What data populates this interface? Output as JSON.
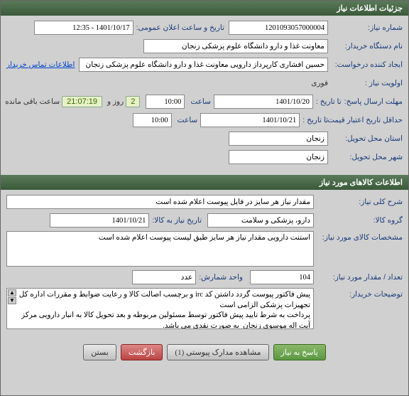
{
  "header": {
    "title": "جزئیات اطلاعات نیاز"
  },
  "form": {
    "need_number_label": "شماره نیاز:",
    "need_number": "1201093057000004",
    "public_date_label": "تاریخ و ساعت اعلان عمومی:",
    "public_date": "1401/10/17 - 12:35",
    "buyer_name_label": "نام دستگاه خریدار:",
    "buyer_name": "معاونت غذا و دارو دانشگاه علوم پزشکی زنجان",
    "requester_label": "ایجاد کننده درخواست:",
    "requester": "حسین افشاری کارپرداز دارویی معاونت غذا و دارو دانشگاه علوم پزشکی زنجان",
    "buyer_contact_link": "اطلاعات تماس خریدار",
    "priority_label": "اولویت نیاز :",
    "priority": "فوری",
    "reply_deadline_label": "مهلت ارسال پاسخ:",
    "to_date_label": "تا تاریخ :",
    "reply_date": "1401/10/20",
    "reply_time_label": "ساعت",
    "reply_time": "10:00",
    "remaining_days": "2",
    "remaining_days_label": "روز و",
    "remaining_time": "21:07:19",
    "remaining_suffix": "ساعت باقی مانده",
    "credit_deadline_label": "حداقل تاریخ اعتبار قیمت:",
    "credit_date": "1401/10/21",
    "credit_time_label": "ساعت",
    "credit_time": "10:00",
    "delivery_state_label": "استان محل تحویل:",
    "delivery_state": "زنجان",
    "delivery_city_label": "شهر محل تحویل:",
    "delivery_city": "زنجان"
  },
  "goods_section": {
    "title": "اطلاعات کالاهای مورد نیاز",
    "need_desc_label": "شرح کلی نیاز:",
    "need_desc": "مقدار نیاز هر سایز در فایل پیوست اعلام شده است",
    "goods_group_label": "گروه کالا:",
    "goods_group": "دارو، پزشکی و سلامت",
    "need_to_goods_date_label": "تاریخ نیاز به کالا:",
    "need_to_goods_date": "1401/10/21",
    "goods_spec_label": "مشخصات کالای مورد نیاز:",
    "goods_spec": "استنت دارویی مقدار نیاز هر سایز طبق لیست پیوست اعلام شده است",
    "qty_label": "تعداد / مقدار مورد نیاز:",
    "qty": "104",
    "unit_label": "واحد شمارش:",
    "unit": "عدد",
    "buyer_notes_label": "توضیحات خریدار:",
    "buyer_notes": "پیش فاکتور پیوست گردد داشتن کد irc و برچسب اصالت کالا و رعایت ضوابط و مقررات اداره کل تجهیزات پزشکی الزامی است\nپرداخت به شرط تایید پیش فاکتور توسط مسئولین مربوطه و بعد تحویل کالا به انبار دارویی مرکز آیت اله موسوی زنجان  به صورت نقدی می باشد."
  },
  "buttons": {
    "reply": "پاسخ به نیاز",
    "attachments": "مشاهده مدارک پیوستی (1)",
    "back": "بازگشت",
    "close": "بستن"
  }
}
